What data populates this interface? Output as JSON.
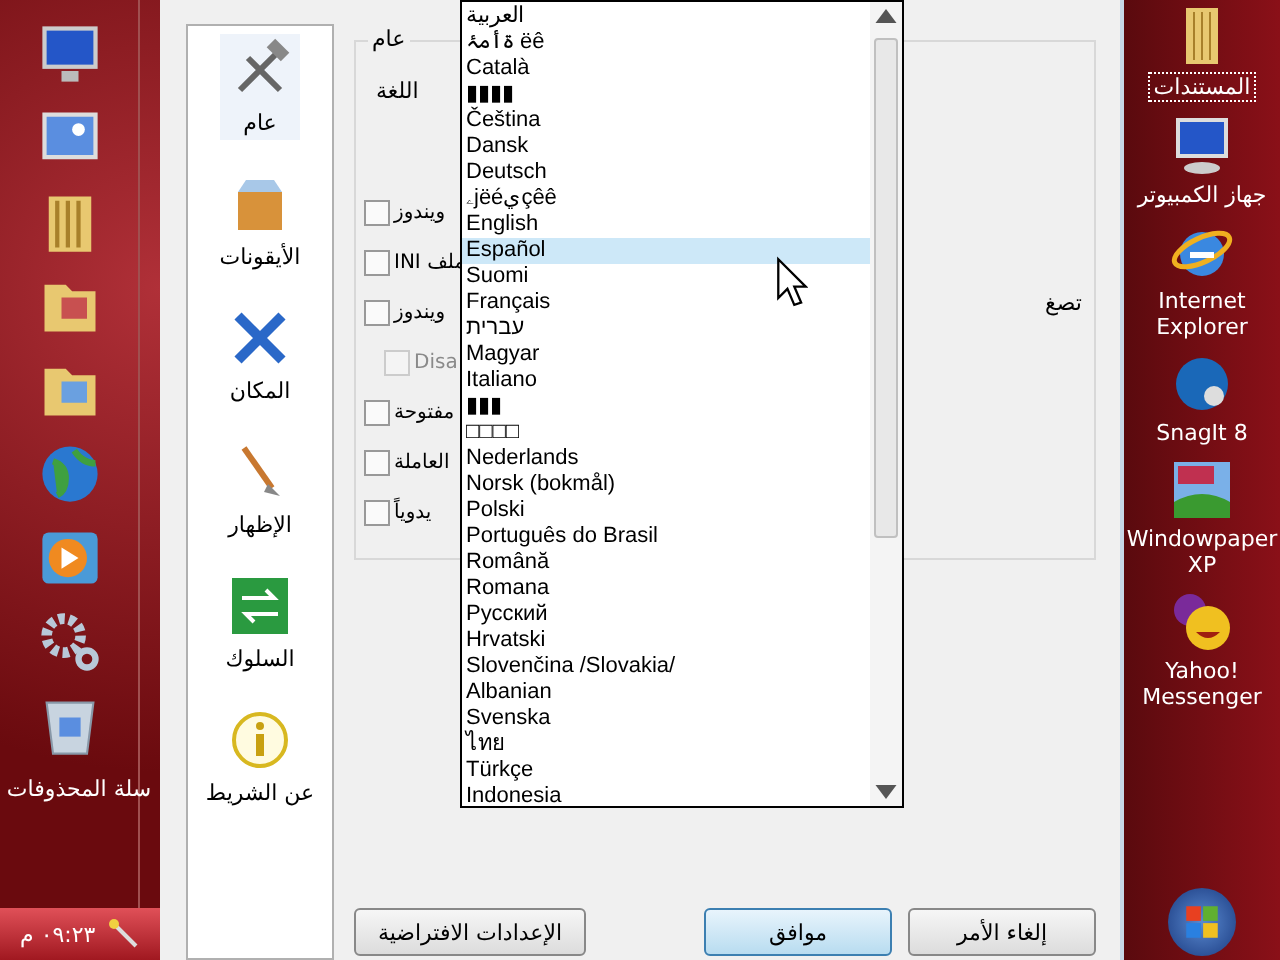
{
  "left_dock": {
    "recycle_label": "سلة المحذوفات"
  },
  "taskbar": {
    "clock": "٠٩:٢٣ م"
  },
  "dialog": {
    "nav": [
      {
        "label": "عام",
        "selected": true
      },
      {
        "label": "الأيقونات",
        "selected": false
      },
      {
        "label": "المكان",
        "selected": false
      },
      {
        "label": "الإظهار",
        "selected": false
      },
      {
        "label": "السلوك",
        "selected": false
      },
      {
        "label": "عن الشريط",
        "selected": false
      }
    ],
    "group_title": "عام",
    "language_label": "اللغة",
    "options": [
      {
        "label": "ويندوز",
        "checked": false,
        "disabled": false
      },
      {
        "label": "ملف INI",
        "checked": false,
        "disabled": false
      },
      {
        "label": "ويندوز",
        "checked": false,
        "disabled": false
      },
      {
        "label": "Disa",
        "checked": false,
        "disabled": true
      },
      {
        "label": "مفتوحة",
        "checked": false,
        "disabled": false
      },
      {
        "label": "العاملة",
        "checked": false,
        "disabled": false
      },
      {
        "label": "يدوياً",
        "checked": false,
        "disabled": false
      }
    ],
    "side_label": "تصغ",
    "language_list": [
      {
        "label": "العربية",
        "selected": false
      },
      {
        "label": "ۃأمۂ ëê",
        "selected": false
      },
      {
        "label": "Català",
        "selected": false
      },
      {
        "label": "▮▮▮▮",
        "selected": false
      },
      {
        "label": "Čeština",
        "selected": false
      },
      {
        "label": "Dansk",
        "selected": false
      },
      {
        "label": "Deutsch",
        "selected": false
      },
      {
        "label": "ۦjëéيçêê",
        "selected": false
      },
      {
        "label": "English",
        "selected": false
      },
      {
        "label": "Español",
        "selected": true
      },
      {
        "label": "Suomi",
        "selected": false
      },
      {
        "label": "Français",
        "selected": false
      },
      {
        "label": "עברית",
        "selected": false
      },
      {
        "label": "Magyar",
        "selected": false
      },
      {
        "label": "Italiano",
        "selected": false
      },
      {
        "label": "▮▮▮",
        "selected": false
      },
      {
        "label": "□□□□",
        "selected": false
      },
      {
        "label": "Nederlands",
        "selected": false
      },
      {
        "label": "Norsk (bokmål)",
        "selected": false
      },
      {
        "label": "Polski",
        "selected": false
      },
      {
        "label": "Português do Brasil",
        "selected": false
      },
      {
        "label": "Română",
        "selected": false
      },
      {
        "label": "Romana",
        "selected": false
      },
      {
        "label": "Русский",
        "selected": false
      },
      {
        "label": "Hrvatski",
        "selected": false
      },
      {
        "label": "Slovenčina /Slovakia/",
        "selected": false
      },
      {
        "label": "Albanian",
        "selected": false
      },
      {
        "label": "Svenska",
        "selected": false
      },
      {
        "label": "ไทย",
        "selected": false
      },
      {
        "label": "Türkçe",
        "selected": false
      },
      {
        "label": "Indonesia",
        "selected": false
      }
    ],
    "buttons": {
      "defaults": "الإعدادات الافتراضية",
      "ok": "موافق",
      "cancel": "إلغاء الأمر"
    }
  },
  "right_desktop": [
    {
      "label": "المستندات",
      "focused": true
    },
    {
      "label": "جهاز الكمبيوتر",
      "focused": false
    },
    {
      "label": "Internet Explorer",
      "focused": false
    },
    {
      "label": "SnagIt 8",
      "focused": false
    },
    {
      "label": "Windowpaper XP",
      "focused": false
    },
    {
      "label": "Yahoo! Messenger",
      "focused": false
    }
  ]
}
